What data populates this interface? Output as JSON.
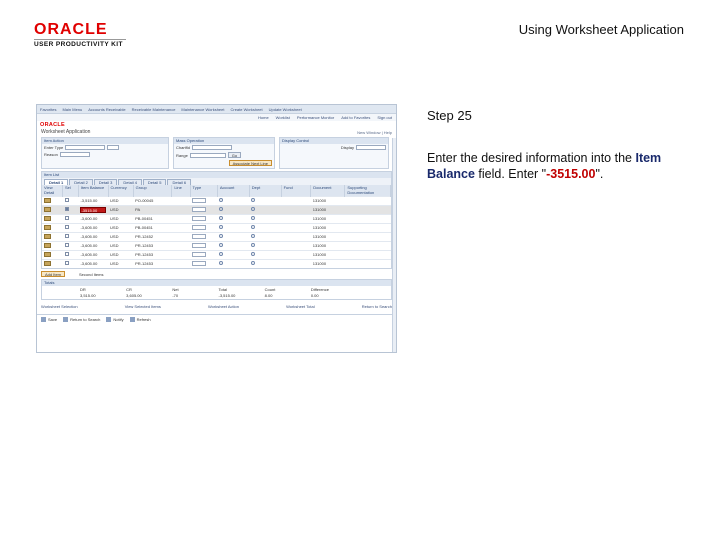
{
  "slide": {
    "title": "Using Worksheet Application",
    "logo_word": "ORACLE",
    "logo_sub": "USER PRODUCTIVITY KIT",
    "step": "Step 25",
    "instruction_pre": "Enter the desired information into the ",
    "instruction_field": "Item Balance",
    "instruction_mid": " field. Enter \"",
    "instruction_value": "-3515.00",
    "instruction_post": "\"."
  },
  "colors": {
    "oracle_red": "#e00000",
    "highlight_red": "#c01818",
    "field_blue": "#1a2a6c"
  },
  "screen": {
    "topbar": [
      "Favorites",
      "Main Menu",
      "Accounts Receivable",
      "Receivable Maintenance",
      "Maintenance Worksheet",
      "Create Worksheet",
      "Update Worksheet"
    ],
    "nav2": [
      "Home",
      "Worklist",
      "Performance Monitor",
      "Add to Favorites",
      "Sign out"
    ],
    "brand": "ORACLE",
    "page_title": "Worksheet Application",
    "page_title_right": "New Window | Help",
    "filter_a": {
      "title": "Item Action",
      "label1": "Enter Type",
      "label2": "Reason"
    },
    "filter_b": {
      "title": "Mass Operation",
      "label1": "Chartfld",
      "label2": "Range",
      "go": "Go",
      "assoc": "Associate Next Line"
    },
    "filter_c": {
      "title": "Display Control",
      "label1": "Display"
    },
    "items_title": "Item List",
    "tabs": [
      "Detail 1",
      "Detail 2",
      "Detail 3",
      "Detail 4",
      "Detail 5",
      "Detail 6"
    ],
    "columns": [
      "View Detail",
      "Sel",
      "Item Balance",
      "Currency",
      "Group",
      "Line",
      "Type",
      "Account",
      "Dept",
      "Fund",
      "Document",
      "Supporting Documentation"
    ],
    "rows": [
      {
        "sel": false,
        "balance": "-3,515.00",
        "cur": "USD",
        "ref": "PO-00045",
        "acct": "131000"
      },
      {
        "sel": true,
        "balance": "-3515.00",
        "cur": "USD",
        "ref": "PA",
        "acct": "131000"
      },
      {
        "sel": false,
        "balance": "-3,600.00",
        "cur": "USD",
        "ref": "PB-00451",
        "acct": "131000"
      },
      {
        "sel": false,
        "balance": "-3,605.00",
        "cur": "USD",
        "ref": "PB-00451",
        "acct": "131000"
      },
      {
        "sel": false,
        "balance": "-3,605.00",
        "cur": "USD",
        "ref": "PR-12452",
        "acct": "131000"
      },
      {
        "sel": false,
        "balance": "-3,605.00",
        "cur": "USD",
        "ref": "PR-12453",
        "acct": "131000"
      },
      {
        "sel": false,
        "balance": "-3,605.00",
        "cur": "USD",
        "ref": "PR-12453",
        "acct": "131000"
      },
      {
        "sel": false,
        "balance": "-3,605.00",
        "cur": "USD",
        "ref": "PR-12453",
        "acct": "131000"
      }
    ],
    "add_button": "Add Item",
    "add_row_hint": "Second Items",
    "totals_title": "Totals",
    "totals_labels": [
      "DR",
      "CR",
      "Net",
      "Total",
      "Count",
      "Difference"
    ],
    "totals_values": [
      "3,515.00",
      "3,605.00",
      "-70",
      "-3,515.00",
      "8.00",
      "0.00"
    ],
    "bottom_links": [
      "Worksheet Selection",
      "View Selected Items",
      "Worksheet Action",
      "Worksheet Total",
      "Return to Search"
    ],
    "toolbar": [
      "Save",
      "Return to Search",
      "Notify",
      "Refresh"
    ]
  }
}
